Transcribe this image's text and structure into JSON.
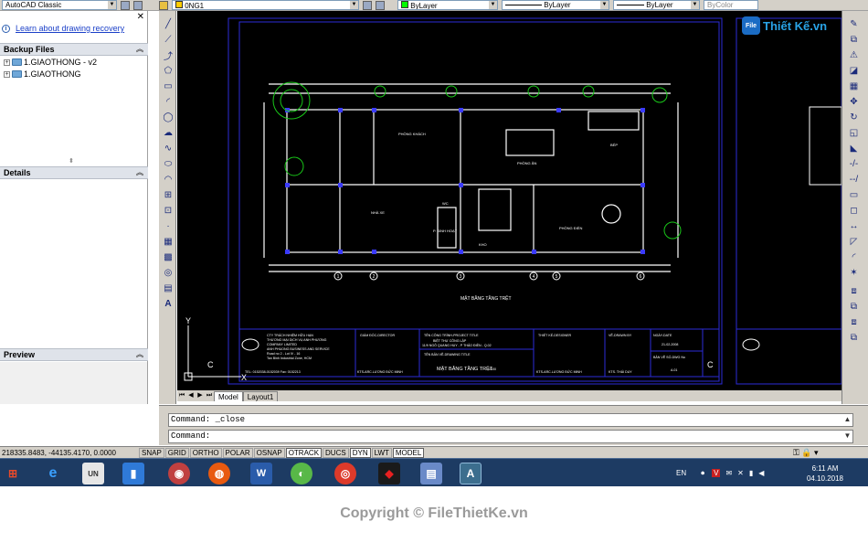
{
  "toolbar": {
    "workspace": "AutoCAD Classic",
    "layer": "0NG1",
    "color": "ByLayer",
    "linetype": "ByLayer",
    "lineweight": "ByLayer",
    "plotstyle": "ByColor",
    "accent_color": "#ffcc00"
  },
  "palette": {
    "recovery_link": "Learn about drawing recovery",
    "backup_title": "Backup Files",
    "backup_items": [
      "1.GIAOTHONG - v2",
      "1.GIAOTHONG"
    ],
    "details_title": "Details",
    "preview_title": "Preview"
  },
  "logo": {
    "badge": "File",
    "text": "Thiết Kế.vn"
  },
  "drawing": {
    "rooms": [
      "PHÒNG KHÁCH",
      "PHÒNG ĂN",
      "BẾP",
      "NHÀ XE",
      "WC",
      "P. SINH HOẠT",
      "KHO",
      "PHÒNG ĐIỂN"
    ],
    "drawing_title": "MẶT BẰNG TẦNG TRỆT",
    "title_block": {
      "company_1": "CTY TRÁCH NHIỆM HỮU HẠN",
      "company_2": "THƯƠNG MẠI DỊCH VỤ ANH PHƯƠNG",
      "company_3": "COMPANY LIMITED",
      "company_4": "ANH PHUONG BUSINESS AND SERVICE",
      "address_1": "Road no 2 - Lot IV - 16",
      "address_2": "Tan Binh Industrial Zone, HCM",
      "tel": "TEL: 0152038-0152039   Fax: 0152213",
      "director_label": "GIÁM ĐỐC-DIRECTOR",
      "project_label": "TÊN CÔNG TRÌNH-PROJECT TITLE",
      "project_name": "BIỆT THỰ CÔNG LẬP",
      "project_addr": "11/9 NGÔ QUANG HUY - P THẢO ĐIỀN - Q.02",
      "sheet_label": "TÊN BẢN VẼ-DRAWING TITLE",
      "sheet_name": "MẶT BẰNG TẦNG TRỆT",
      "designer_label": "THIẾT KẾ-DESIGNER",
      "designer_name": "KTS-ARC.LƯƠNG ĐỨC MINH",
      "drawn_label": "VẼ-DRAWN BY",
      "drawn_name": "KTS. THÁI DUY",
      "date_label": "NGÀY-DATE",
      "date_value": "21-02-2008",
      "dwg_label": "BẢN VẼ SỐ-DWG No",
      "dwg_no": "A.01",
      "director_name": "KTS-ARC.LƯƠNG ĐỨC MINH",
      "sheet_scale": "1/100"
    },
    "axis_labels": [
      "1",
      "2",
      "3",
      "4",
      "5",
      "6"
    ],
    "ucs_y": "Y",
    "ucs_x": "X",
    "ucs_c": "C",
    "layout_c": "C"
  },
  "tabs": {
    "model": "Model",
    "layout1": "Layout1"
  },
  "command": {
    "history": "Command: _close",
    "prompt": "Command:"
  },
  "status": {
    "coords": "218335.8483, -44135.4170, 0.0000",
    "buttons": [
      {
        "label": "SNAP",
        "on": false
      },
      {
        "label": "GRID",
        "on": false
      },
      {
        "label": "ORTHO",
        "on": false
      },
      {
        "label": "POLAR",
        "on": false
      },
      {
        "label": "OSNAP",
        "on": false
      },
      {
        "label": "OTRACK",
        "on": true
      },
      {
        "label": "DUCS",
        "on": false
      },
      {
        "label": "DYN",
        "on": true
      },
      {
        "label": "LWT",
        "on": false
      },
      {
        "label": "MODEL",
        "on": true
      }
    ]
  },
  "taskbar": {
    "lang": "EN",
    "time": "6:11 AM",
    "date": "04.10.2018"
  },
  "watermark": "Copyright © FileThietKe.vn"
}
